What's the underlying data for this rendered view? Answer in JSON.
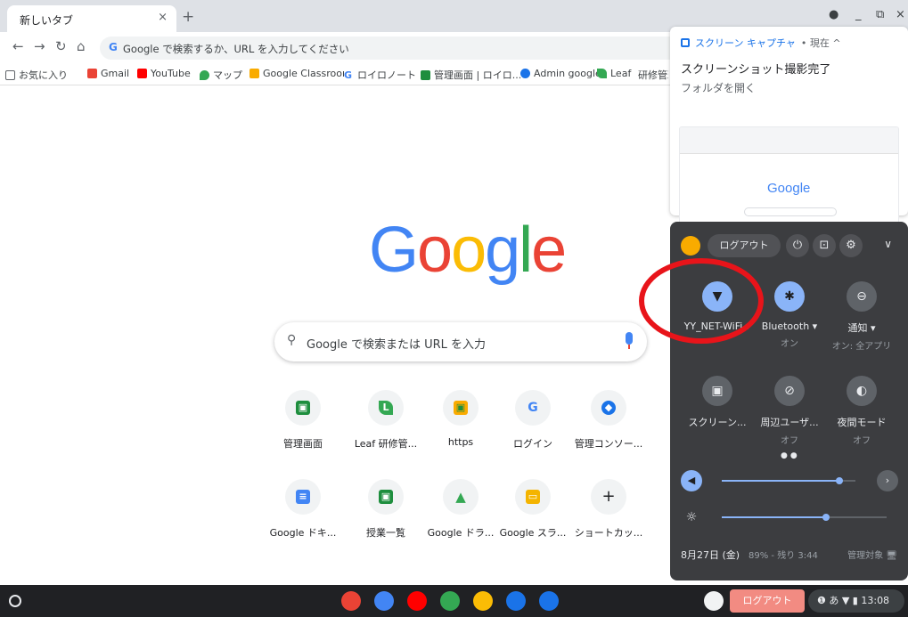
{
  "browser": {
    "tab_title": "新しいタブ",
    "tab_close": "×",
    "new_tab": "+",
    "omnibox_text": "Google で検索するか、URL を入力してください",
    "bookmarks": [
      {
        "label": "お気に入り",
        "icon_color": "#5f6368"
      },
      {
        "label": "Gmail",
        "icon_color": "#ea4335"
      },
      {
        "label": "YouTube",
        "icon_color": "#ff0000"
      },
      {
        "label": "マップ",
        "icon_color": "#34a853"
      },
      {
        "label": "Google Classroom",
        "icon_color": "#f9ab00"
      },
      {
        "label": "ロイロノート",
        "icon_color": "#4285f4"
      },
      {
        "label": "管理画面 | ロイロ...",
        "icon_color": "#1e8e3e"
      },
      {
        "label": "Admin google",
        "icon_color": "#1a73e8"
      },
      {
        "label": "Leaf",
        "icon_color": "#34a853"
      },
      {
        "label": "研修管理",
        "icon_color": "#188038"
      }
    ]
  },
  "ntp": {
    "logo": [
      "G",
      "o",
      "o",
      "g",
      "l",
      "e"
    ],
    "search_placeholder": "Google で検索または URL を入力",
    "shortcuts": [
      {
        "label": "管理画面",
        "icon_color": "#1e8e3e",
        "glyph": "▣"
      },
      {
        "label": "Leaf  研修管...",
        "icon_color": "#34a853",
        "glyph": "L"
      },
      {
        "label": "https",
        "icon_color": "#f9ab00",
        "glyph": "▣"
      },
      {
        "label": "ログイン",
        "icon_color": "#4285f4",
        "glyph": "G"
      },
      {
        "label": "管理コンソー...",
        "icon_color": "#1a73e8",
        "glyph": "◆"
      },
      {
        "label": "Google ドキ...",
        "icon_color": "#4285f4",
        "glyph": "≡"
      },
      {
        "label": "授業一覧",
        "icon_color": "#1e8e3e",
        "glyph": "▣"
      },
      {
        "label": "Google ドラ...",
        "icon_color": "#fbbc05",
        "glyph": "▲"
      },
      {
        "label": "Google スラ...",
        "icon_color": "#f4b400",
        "glyph": "▭"
      },
      {
        "label": "ショートカッ...",
        "icon_color": "#f1f3f4",
        "glyph": "+"
      }
    ]
  },
  "notification": {
    "app_name": "スクリーン キャプチャ",
    "time": "• 現在 ^",
    "title": "スクリーンショット撮影完了",
    "body": "フォルダを開く",
    "thumb_logo": "Google"
  },
  "quick_settings": {
    "logout": "ログアウト",
    "tiles": [
      {
        "label": "YY_NET-WiFi ▾",
        "sub": "",
        "state": "on",
        "icon": "wifi-icon",
        "glyph": "▼"
      },
      {
        "label": "Bluetooth ▾",
        "sub": "オン",
        "state": "on",
        "icon": "bluetooth-icon",
        "glyph": "✱"
      },
      {
        "label": "通知 ▾",
        "sub": "オン: 全アプリ",
        "state": "off",
        "icon": "notifications-icon",
        "glyph": "⊖"
      },
      {
        "label": "スクリーン...",
        "sub": "",
        "state": "off",
        "icon": "screen-capture-icon",
        "glyph": "▣"
      },
      {
        "label": "周辺ユーザ...",
        "sub": "オフ",
        "state": "off",
        "icon": "nearby-share-icon",
        "glyph": "⊘"
      },
      {
        "label": "夜間モード",
        "sub": "オフ",
        "state": "off",
        "icon": "night-light-icon",
        "glyph": "◐"
      }
    ],
    "volume_level": 0.88,
    "brightness_level": 0.63,
    "date": "8月27日 (金)",
    "battery": "89% - 残り 3:44",
    "managed": "管理対象 🖥"
  },
  "shelf": {
    "logout": "ログアウト",
    "status": "❶ あ ▼ ▮ 13:08",
    "apps": [
      {
        "name": "chrome-icon",
        "color": "#ea4335"
      },
      {
        "name": "docs-icon",
        "color": "#4285f4"
      },
      {
        "name": "youtube-icon",
        "color": "#ff0000"
      },
      {
        "name": "play-store-icon",
        "color": "#34a853"
      },
      {
        "name": "drive-icon",
        "color": "#fbbc05"
      },
      {
        "name": "camera-icon",
        "color": "#1a73e8"
      },
      {
        "name": "files-icon",
        "color": "#1a73e8"
      }
    ]
  },
  "colors": {
    "google_blue": "#4285f4",
    "google_red": "#ea4335",
    "google_yellow": "#fbbc05",
    "google_green": "#34a853",
    "highlight_red": "#e8141a"
  }
}
